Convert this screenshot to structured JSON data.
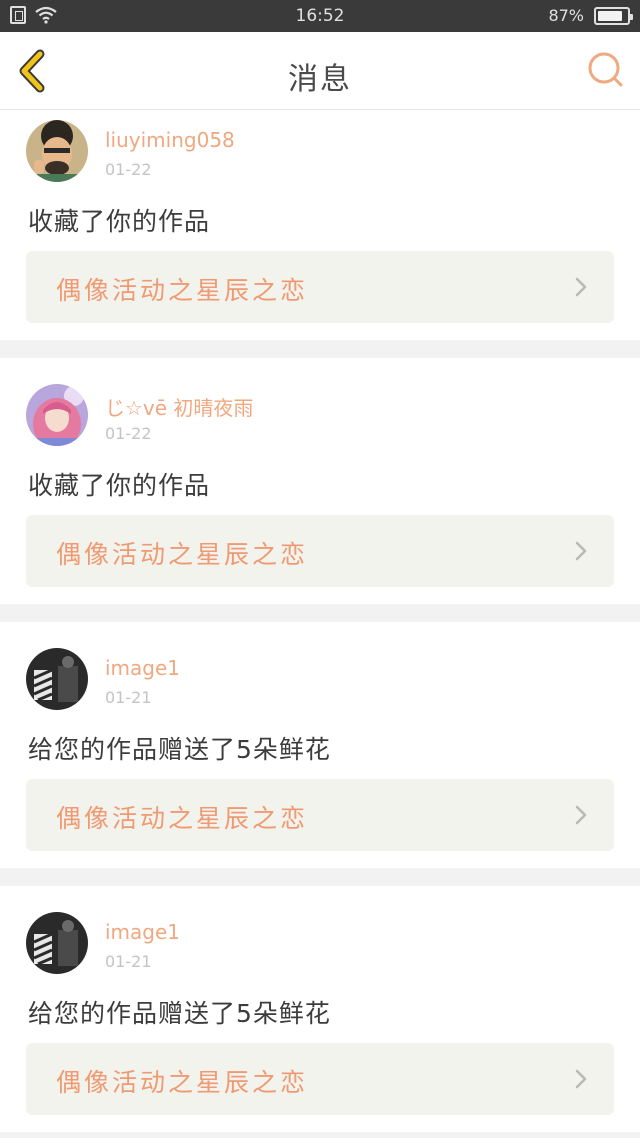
{
  "status_bar": {
    "time": "16:52",
    "battery": "87%",
    "battery_level": 0.87
  },
  "header": {
    "title": "消息",
    "back_icon": "chevron-left-icon",
    "search_icon": "search-icon"
  },
  "colors": {
    "accent": "#f0a880",
    "link_text": "#ef9a72",
    "back_yellow": "#f0c419",
    "link_bg": "#f3f3ed"
  },
  "messages": [
    {
      "username": "liuyiming058",
      "date": "01-22",
      "action": "收藏了你的作品",
      "work": "偶像活动之星辰之恋"
    },
    {
      "username": "じ☆vē 初晴夜雨",
      "date": "01-22",
      "action": "收藏了你的作品",
      "work": "偶像活动之星辰之恋"
    },
    {
      "username": "image1",
      "date": "01-21",
      "action": "给您的作品赠送了5朵鲜花",
      "work": "偶像活动之星辰之恋"
    },
    {
      "username": "image1",
      "date": "01-21",
      "action": "给您的作品赠送了5朵鲜花",
      "work": "偶像活动之星辰之恋"
    }
  ]
}
